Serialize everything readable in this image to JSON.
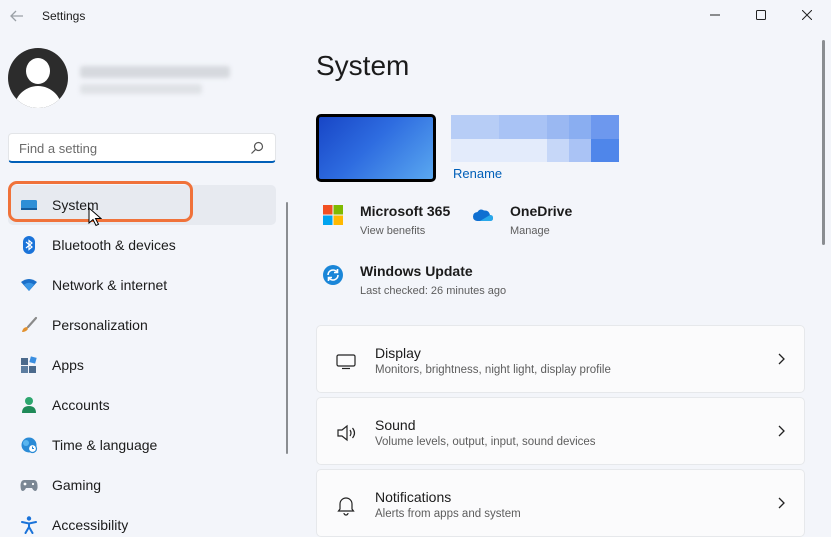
{
  "window": {
    "title": "Settings"
  },
  "search": {
    "placeholder": "Find a setting"
  },
  "sidebar": {
    "items": [
      {
        "label": "System",
        "icon": "system-icon",
        "selected": true
      },
      {
        "label": "Bluetooth & devices",
        "icon": "bluetooth-icon"
      },
      {
        "label": "Network & internet",
        "icon": "wifi-icon"
      },
      {
        "label": "Personalization",
        "icon": "brush-icon"
      },
      {
        "label": "Apps",
        "icon": "apps-icon"
      },
      {
        "label": "Accounts",
        "icon": "accounts-icon"
      },
      {
        "label": "Time & language",
        "icon": "globe-clock-icon"
      },
      {
        "label": "Gaming",
        "icon": "gamepad-icon"
      },
      {
        "label": "Accessibility",
        "icon": "accessibility-icon"
      }
    ]
  },
  "main": {
    "title": "System",
    "device": {
      "rename_label": "Rename"
    },
    "tiles": [
      {
        "title": "Microsoft 365",
        "subtitle": "View benefits",
        "icon": "microsoft-logo-icon"
      },
      {
        "title": "OneDrive",
        "subtitle": "Manage",
        "icon": "onedrive-cloud-icon"
      },
      {
        "title": "Windows Update",
        "subtitle": "Last checked: 26 minutes ago",
        "icon": "update-sync-icon"
      }
    ],
    "cards": [
      {
        "title": "Display",
        "subtitle": "Monitors, brightness, night light, display profile",
        "icon": "display-icon"
      },
      {
        "title": "Sound",
        "subtitle": "Volume levels, output, input, sound devices",
        "icon": "speaker-icon"
      },
      {
        "title": "Notifications",
        "subtitle": "Alerts from apps and system",
        "icon": "bell-icon"
      }
    ]
  },
  "colors": {
    "accent": "#005fb8",
    "highlight": "#f0723a",
    "background": "#f3f5fa"
  }
}
